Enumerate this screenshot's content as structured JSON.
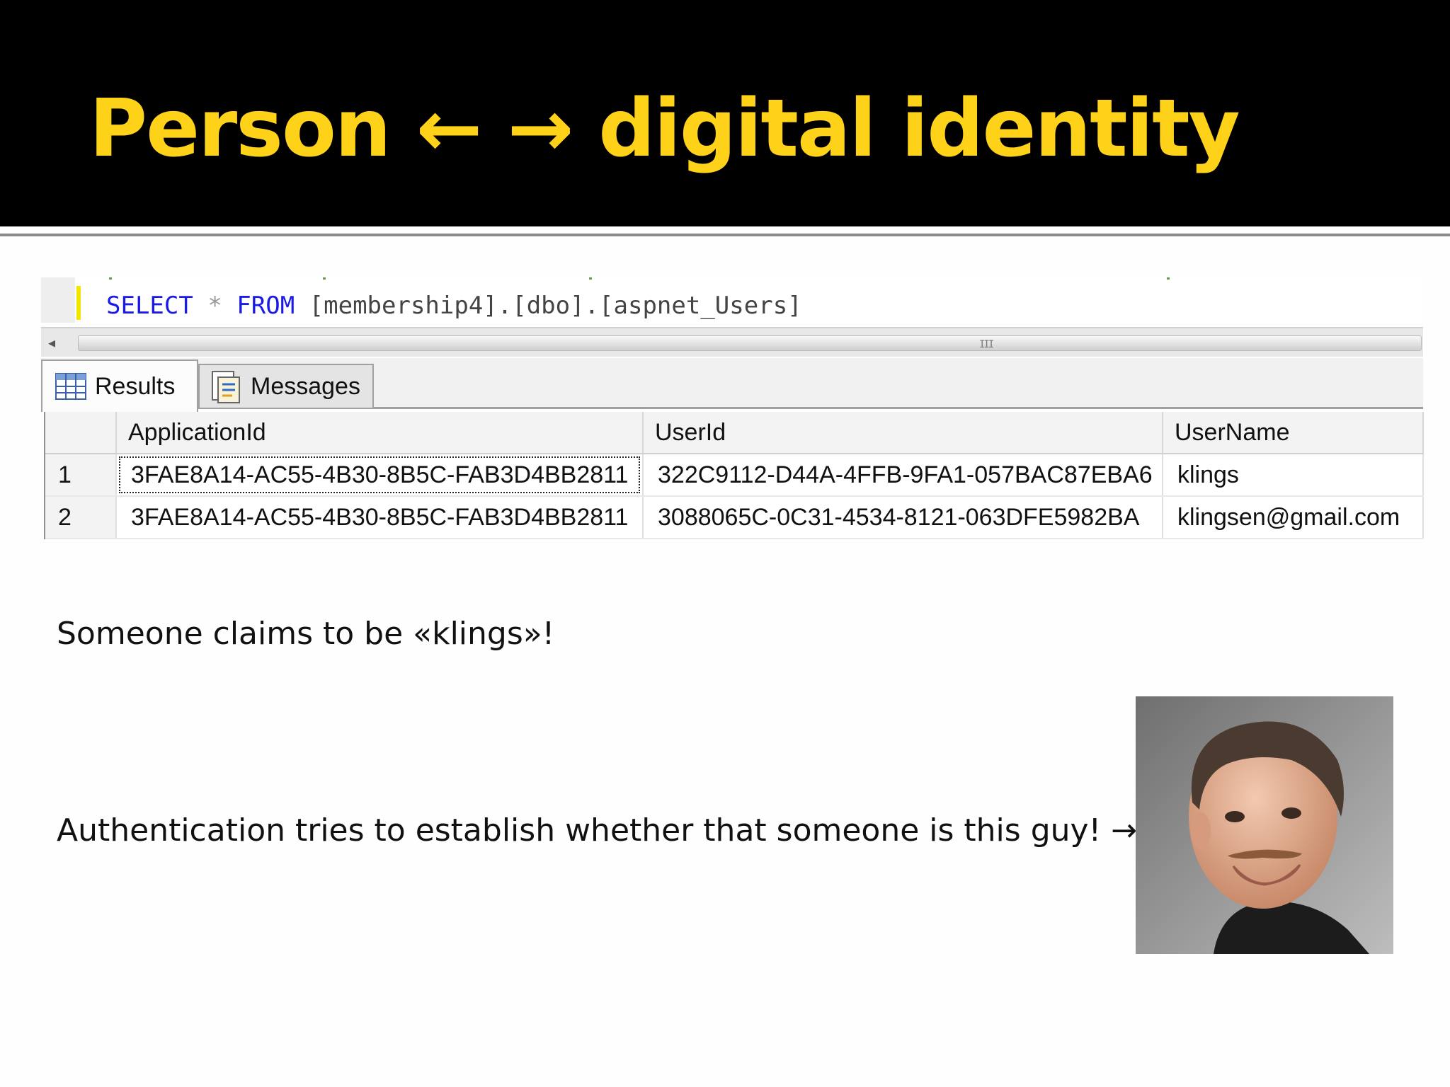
{
  "slide": {
    "title": "Person ← → digital identity"
  },
  "editor": {
    "tokens": {
      "select": "SELECT",
      "star": "*",
      "from": "FROM",
      "target": "[membership4].[dbo].[aspnet_Users]"
    },
    "keyword_color": "#1a1ae6"
  },
  "scrollbar": {
    "left_arrow": "◂",
    "grip": "III"
  },
  "tabs": [
    {
      "label": "Results",
      "icon": "grid-icon",
      "active": true
    },
    {
      "label": "Messages",
      "icon": "messages-icon",
      "active": false
    }
  ],
  "grid": {
    "columns": [
      "ApplicationId",
      "UserId",
      "UserName"
    ],
    "rows": [
      {
        "num": "1",
        "cells": [
          "3FAE8A14-AC55-4B30-8B5C-FAB3D4BB2811",
          "322C9112-D44A-4FFB-9FA1-057BAC87EBA6",
          "klings"
        ]
      },
      {
        "num": "2",
        "cells": [
          "3FAE8A14-AC55-4B30-8B5C-FAB3D4BB2811",
          "3088065C-0C31-4534-8121-063DFE5982BA",
          "klingsen@gmail.com"
        ]
      }
    ]
  },
  "text": {
    "claim": "Someone claims to be «klings»!",
    "authentication": "Authentication tries to establish whether that someone is this guy! →"
  },
  "colors": {
    "title": "#ffd21a",
    "header_bg": "#000000"
  }
}
